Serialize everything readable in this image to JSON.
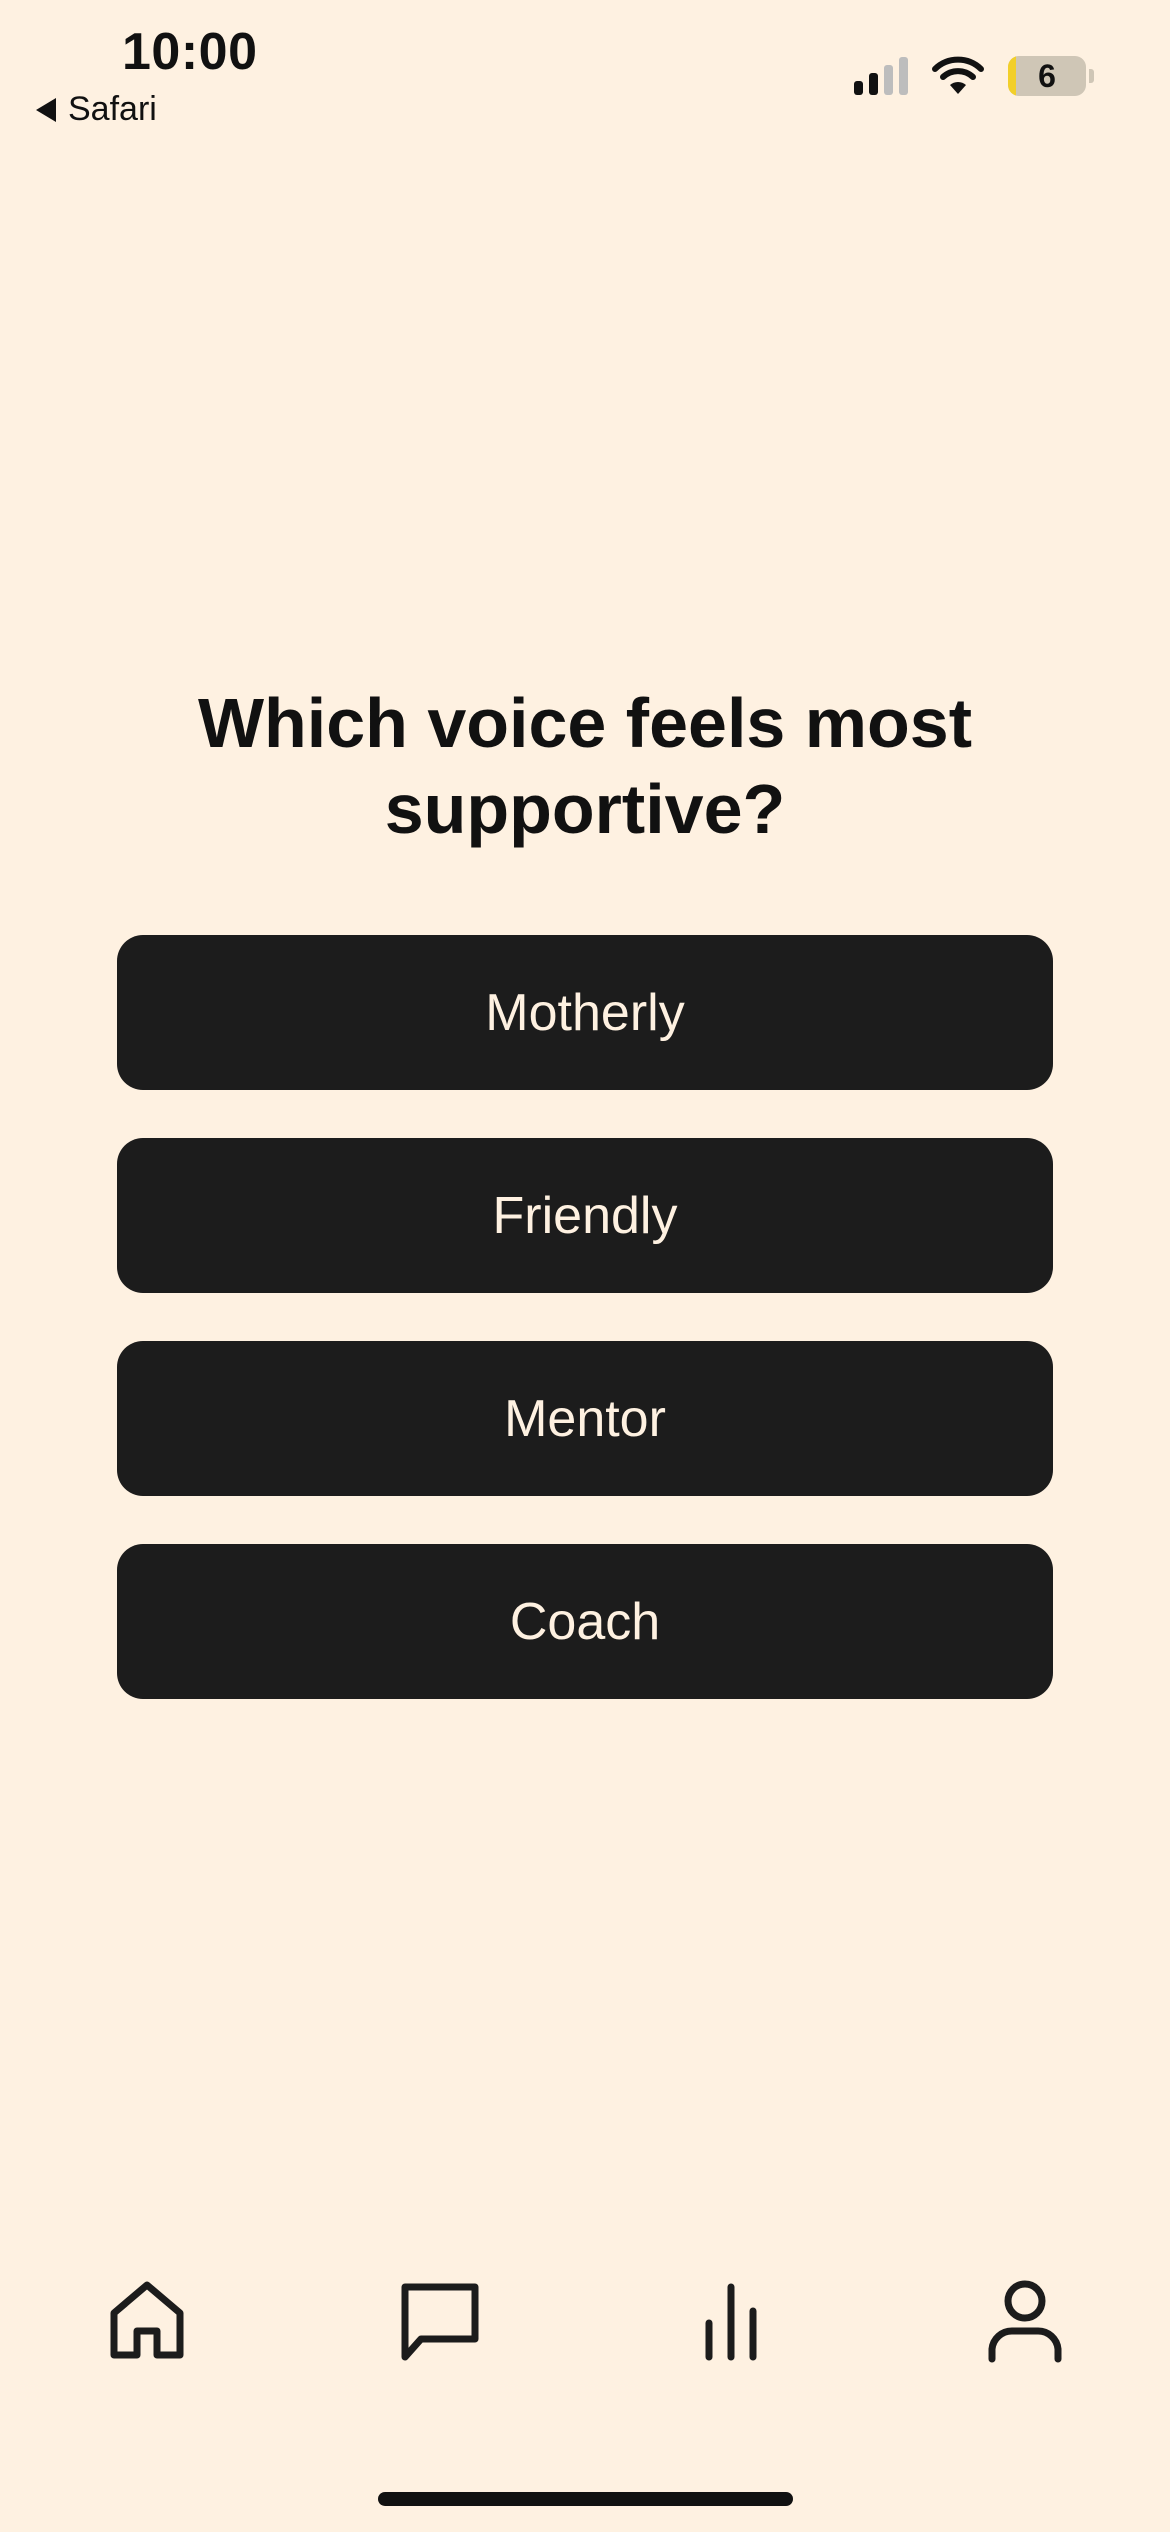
{
  "status_bar": {
    "time": "10:00",
    "back_label": "Safari",
    "battery_level": "6",
    "icons": [
      "signal-icon",
      "wifi-icon",
      "battery-icon"
    ]
  },
  "question": {
    "title": "Which voice feels most supportive?"
  },
  "options": [
    {
      "label": "Motherly"
    },
    {
      "label": "Friendly"
    },
    {
      "label": "Mentor"
    },
    {
      "label": "Coach"
    }
  ],
  "tab_bar": {
    "icons": [
      "home-icon",
      "chat-icon",
      "stats-icon",
      "profile-icon"
    ]
  },
  "colors": {
    "background": "#fef1e1",
    "button": "#1c1c1c",
    "button_text": "#fef1e1",
    "text": "#111111",
    "battery_fill": "#f2cf2a"
  }
}
